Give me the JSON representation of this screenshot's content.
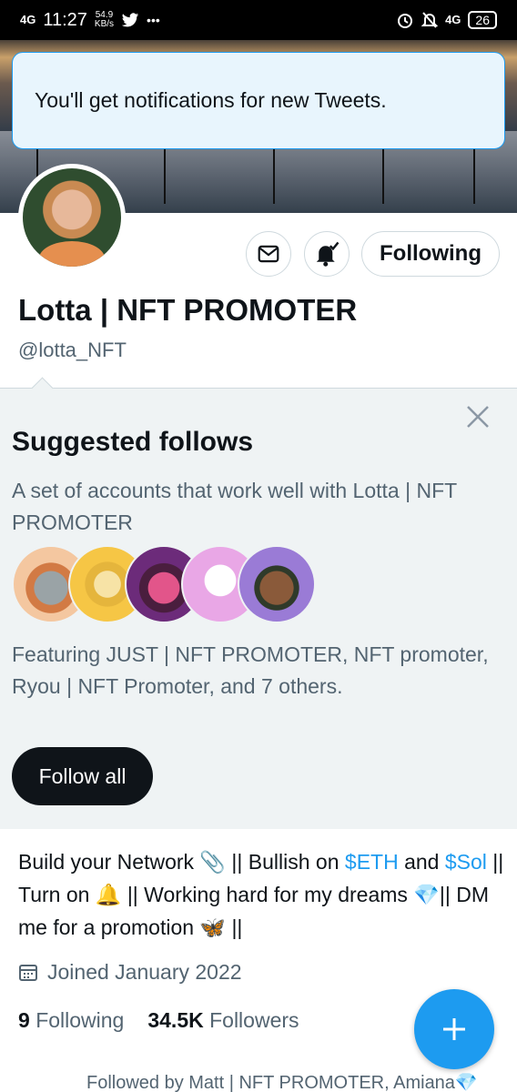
{
  "status_bar": {
    "network": "4G",
    "time": "11:27",
    "speed_value": "54.9",
    "speed_unit": "KB/s",
    "more": "•••",
    "right_network": "4G",
    "battery": "26"
  },
  "toast": {
    "text": "You'll get notifications for new Tweets."
  },
  "profile": {
    "following_label": "Following",
    "name": "Lotta | NFT PROMOTER",
    "handle": "@lotta_NFT"
  },
  "suggested": {
    "title": "Suggested follows",
    "description": "A set of accounts that work well with Lotta | NFT PROMOTER",
    "featuring": "Featuring JUST | NFT PROMOTER, NFT promoter, Ryou | NFT Promoter, and 7 others.",
    "follow_all_label": "Follow all"
  },
  "bio": {
    "part1": "Build your Network 📎 || Bullish on ",
    "link1": "$ETH",
    "part2": " and ",
    "link2": "$Sol",
    "part3": " || Turn on 🔔 || Working hard for my dreams 💎|| DM me for a promotion 🦋 ||"
  },
  "joined": "Joined January 2022",
  "stats": {
    "following_count": "9",
    "following_label": "Following",
    "followers_count": "34.5K",
    "followers_label": "Followers"
  },
  "followed_by": "Followed by Matt | NFT PROMOTER, Amiana💎",
  "colors": {
    "accent": "#1d9bf0",
    "text": "#0f1419",
    "secondary": "#536471",
    "panel": "#eff3f4"
  },
  "icons": [
    "mail-icon",
    "notifications-on-icon",
    "close-icon",
    "calendar-icon",
    "compose-plus-icon",
    "twitter-bird-icon",
    "alarm-icon",
    "mute-icon"
  ]
}
